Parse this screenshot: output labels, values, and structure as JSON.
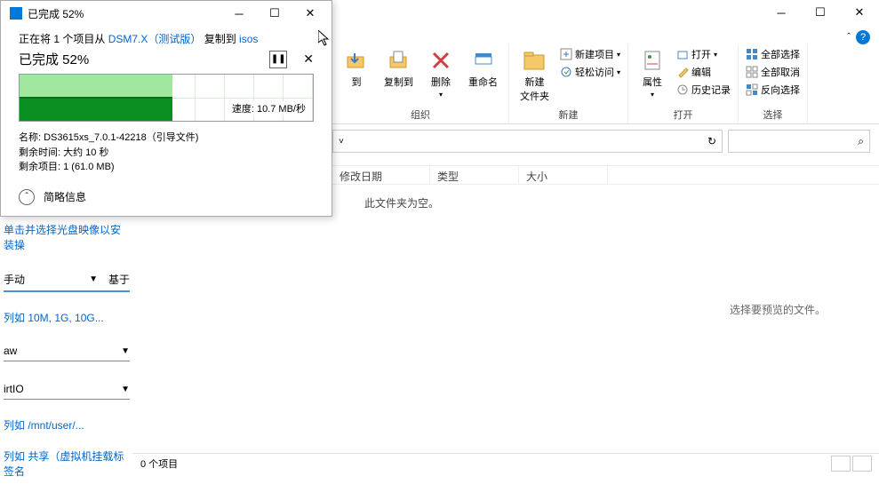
{
  "dialog": {
    "title": "已完成 52%",
    "line1_prefix": "正在将 1 个项目从 ",
    "source": "DSM7.X（测试版）",
    "line1_mid": " 复制到 ",
    "dest": "isos",
    "progress_title": "已完成 52%",
    "progress_percent": 52,
    "speed_label": "速度: 10.7 MB/秒",
    "name_label": "名称: DS3615xs_7.0.1-42218（引导文件)",
    "time_label": "剩余时间: 大约 10 秒",
    "remain_label": "剩余项目: 1 (61.0 MB)",
    "brief_info": "简略信息"
  },
  "ribbon": {
    "moveto": "到",
    "copyto": "复制到",
    "delete": "删除",
    "rename": "重命名",
    "group_org": "组织",
    "newfolder": "新建\n文件夹",
    "newitem": "新建项目",
    "easyaccess": "轻松访问",
    "group_new": "新建",
    "properties": "属性",
    "open": "打开",
    "edit": "编辑",
    "history": "历史记录",
    "group_open": "打开",
    "selectall": "全部选择",
    "selectnone": "全部取消",
    "invert": "反向选择",
    "group_select": "选择"
  },
  "cols": {
    "moddate": "修改日期",
    "type": "类型",
    "size": "大小"
  },
  "content": {
    "empty": "此文件夹为空。",
    "preview": "选择要预览的文件。"
  },
  "statusbar": {
    "items": "0 个项目"
  },
  "left": {
    "link1": "单击并选择光盘映像以安装操",
    "manual": "手动",
    "base": "基于",
    "ex1": "列如 10M, 1G, 10G...",
    "aw": "aw",
    "virtio": "irtIO",
    "ex2": "列如 /mnt/user/...",
    "ex3": "列如 共享（虚拟机挂载标签名"
  }
}
